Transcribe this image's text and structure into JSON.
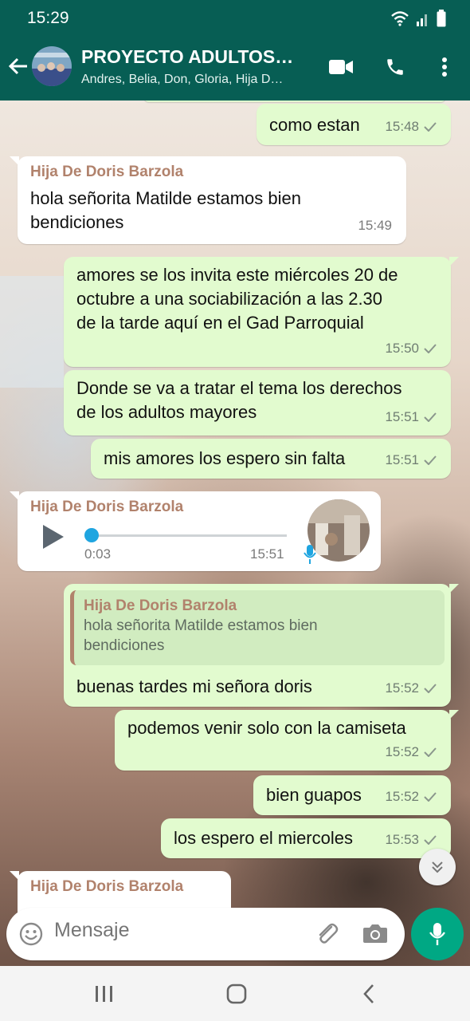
{
  "status_bar": {
    "time": "15:29"
  },
  "header": {
    "title": "PROYECTO ADULTOS…",
    "subtitle": "Andres, Belia, Don, Gloria, Hija D…"
  },
  "messages": [
    {
      "type": "out",
      "text": "como estan",
      "time": "15:48"
    },
    {
      "type": "in",
      "sender": "Hija De Doris Barzola",
      "lines": [
        "hola señorita Matilde estamos bien",
        "bendiciones"
      ],
      "time": "15:49"
    },
    {
      "type": "out",
      "lines": [
        "amores se los invita este miércoles 20 de",
        "octubre a una sociabilización a las 2.30",
        "de la tarde aquí en el Gad Parroquial"
      ],
      "time": "15:50"
    },
    {
      "type": "out",
      "lines": [
        "Donde se va a tratar el tema los derechos",
        "de los adultos mayores"
      ],
      "time": "15:51"
    },
    {
      "type": "out",
      "text": "mis amores los espero sin falta",
      "time": "15:51"
    },
    {
      "type": "voice",
      "sender": "Hija De Doris Barzola",
      "duration": "0:03",
      "time": "15:51",
      "progress": 0
    },
    {
      "type": "out_reply",
      "quote_sender": "Hija De Doris Barzola",
      "quote_lines": [
        "hola señorita Matilde estamos bien",
        "bendiciones"
      ],
      "text": "buenas tardes mi señora doris",
      "time": "15:52"
    },
    {
      "type": "out",
      "text": "podemos venir solo con la camiseta",
      "time": "15:52"
    },
    {
      "type": "out",
      "text": "bien guapos",
      "time": "15:52"
    },
    {
      "type": "out",
      "text": "los espero el miercoles",
      "time": "15:53"
    },
    {
      "type": "in_partial",
      "sender": "Hija De Doris Barzola"
    }
  ],
  "composer": {
    "placeholder": "Mensaje"
  },
  "colors": {
    "header": "#075e54",
    "outgoing": "#e2fbcf",
    "incoming": "#ffffff",
    "accent": "#00a884",
    "sender": "#b1826c"
  },
  "icons": [
    "back-arrow-icon",
    "video-call-icon",
    "phone-icon",
    "more-options-icon",
    "checkmark-icon",
    "play-icon",
    "mic-icon",
    "emoji-icon",
    "attach-icon",
    "camera-icon",
    "chevron-double-down-icon"
  ]
}
